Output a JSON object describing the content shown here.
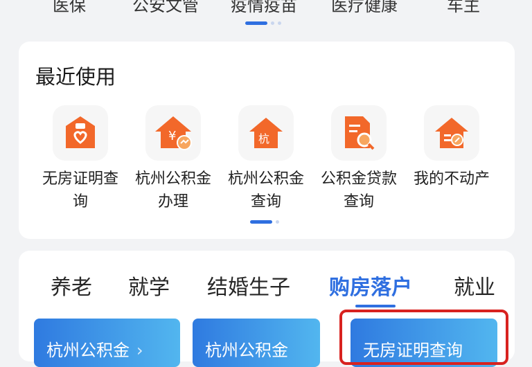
{
  "top_categories": [
    "医保",
    "公安文管",
    "疫情疫苗",
    "医疗健康",
    "车主"
  ],
  "recent": {
    "title": "最近使用",
    "apps": [
      {
        "icon": "certificate-heart-icon",
        "line1": "无房证明查",
        "line2": "询"
      },
      {
        "icon": "house-yuan-icon",
        "line1": "杭州公积金",
        "line2": "办理"
      },
      {
        "icon": "house-hang-icon",
        "line1": "杭州公积金",
        "line2": "查询"
      },
      {
        "icon": "document-search-icon",
        "line1": "公积金贷款",
        "line2": "查询"
      },
      {
        "icon": "house-edit-icon",
        "line1": "我的不动产",
        "line2": ""
      }
    ]
  },
  "tabs": {
    "items": [
      "养老",
      "就学",
      "结婚生子",
      "购房落户",
      "就业"
    ],
    "active_index": 3
  },
  "services": [
    "杭州公积金",
    "杭州公积金",
    "无房证明查询"
  ],
  "colors": {
    "accent": "#2f6fe0",
    "icon_orange": "#f2682a",
    "highlight": "#d8221f"
  }
}
